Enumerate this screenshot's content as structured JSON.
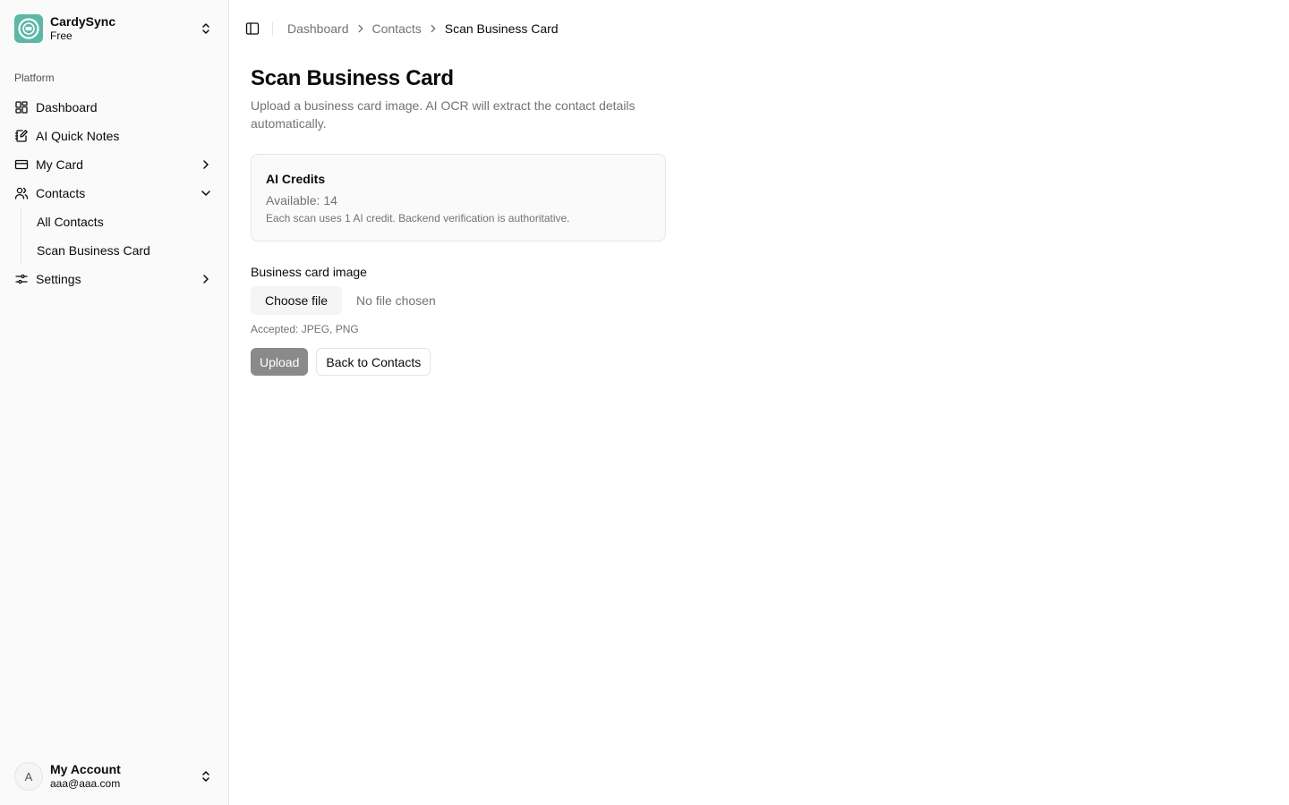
{
  "brand": {
    "name": "CardySync",
    "plan": "Free",
    "accent": "#5bb8a6"
  },
  "sidebar": {
    "group_label": "Platform",
    "items": [
      {
        "label": "Dashboard",
        "icon": "layout-dashboard-icon"
      },
      {
        "label": "AI Quick Notes",
        "icon": "notebook-pen-icon"
      },
      {
        "label": "My Card",
        "icon": "credit-card-icon",
        "chevron": "chevron-right-icon"
      },
      {
        "label": "Contacts",
        "icon": "users-icon",
        "chevron": "chevron-down-icon",
        "expanded": true
      },
      {
        "label": "Settings",
        "icon": "settings-sliders-icon",
        "chevron": "chevron-right-icon"
      }
    ],
    "contacts_sub": [
      {
        "label": "All Contacts"
      },
      {
        "label": "Scan Business Card",
        "active": true
      }
    ]
  },
  "account": {
    "initial": "A",
    "name": "My Account",
    "email": "aaa@aaa.com"
  },
  "header": {
    "breadcrumb": [
      "Dashboard",
      "Contacts",
      "Scan Business Card"
    ]
  },
  "main": {
    "title": "Scan Business Card",
    "description": "Upload a business card image. AI OCR will extract the contact details automatically.",
    "credits": {
      "title": "AI Credits",
      "available": "Available: 14",
      "note": "Each scan uses 1 AI credit. Backend verification is authoritative."
    },
    "file_field": {
      "label": "Business card image",
      "button": "Choose file",
      "status": "No file chosen",
      "hint": "Accepted: JPEG, PNG"
    },
    "actions": {
      "upload": "Upload",
      "back": "Back to Contacts"
    }
  }
}
